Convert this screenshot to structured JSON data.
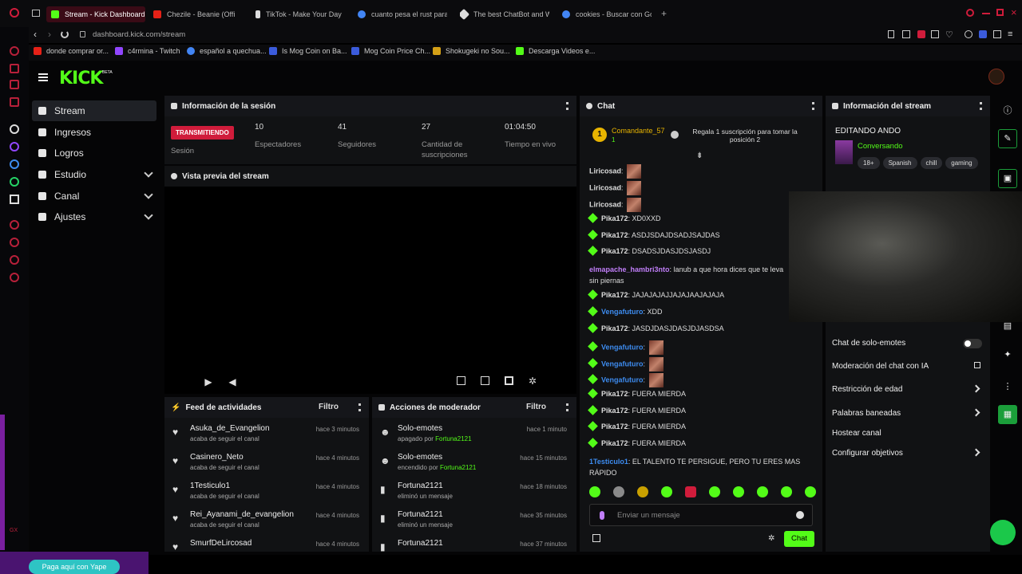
{
  "browser": {
    "tabs": [
      {
        "label": "Stream - Kick Dashboard",
        "color": "#53fc18",
        "active": true
      },
      {
        "label": "Chezile - Beanie (Offi",
        "color": "#e62117"
      },
      {
        "label": "TikTok - Make Your Day",
        "color": "#dddddd"
      },
      {
        "label": "cuanto pesa el rust para p",
        "color": "#4285f4"
      },
      {
        "label": "The best ChatBot and Wi",
        "color": "#dddddd"
      },
      {
        "label": "cookies - Buscar con Goo",
        "color": "#4285f4"
      }
    ],
    "url": "dashboard.kick.com/stream",
    "bookmarks": [
      {
        "label": "donde comprar or...",
        "color": "#e62117"
      },
      {
        "label": "c4rmina - Twitch",
        "color": "#9146ff"
      },
      {
        "label": "español a quechua...",
        "color": "#4285f4"
      },
      {
        "label": "Is Mog Coin on Ba...",
        "color": "#3b5bdb"
      },
      {
        "label": "Mog Coin Price Ch...",
        "color": "#3b5bdb"
      },
      {
        "label": "Shokugeki no Sou...",
        "color": "#d4a017"
      },
      {
        "label": "Descarga Videos e...",
        "color": "#53fc18"
      }
    ]
  },
  "app": {
    "logo": "KICK",
    "beta": "BETA",
    "accent": "#53fc18",
    "sidebar": [
      {
        "label": "Stream",
        "active": true
      },
      {
        "label": "Ingresos"
      },
      {
        "label": "Logros"
      },
      {
        "label": "Estudio",
        "expandable": true
      },
      {
        "label": "Canal",
        "expandable": true
      },
      {
        "label": "Ajustes",
        "expandable": true
      }
    ]
  },
  "session": {
    "title": "Información de la sesión",
    "badge": "TRANSMITIENDO",
    "badge_label": "Sesión",
    "stats": [
      {
        "value": "10",
        "label": "Espectadores"
      },
      {
        "value": "41",
        "label": "Seguidores"
      },
      {
        "value": "27",
        "label": "Cantidad de suscripciones"
      },
      {
        "value": "01:04:50",
        "label": "Tiempo en vivo"
      }
    ]
  },
  "preview": {
    "title": "Vista previa del stream"
  },
  "feed": {
    "title": "Feed de actividades",
    "filter": "Filtro",
    "rows": [
      {
        "name": "Asuka_de_Evangelion",
        "sub": "acaba de seguir el canal",
        "time": "hace 3 minutos"
      },
      {
        "name": "Casinero_Neto",
        "sub": "acaba de seguir el canal",
        "time": "hace 4 minutos"
      },
      {
        "name": "1Testiculo1",
        "sub": "acaba de seguir el canal",
        "time": "hace 4 minutos"
      },
      {
        "name": "Rei_Ayanami_de_evangelion",
        "sub": "acaba de seguir el canal",
        "time": "hace 4 minutos"
      },
      {
        "name": "SmurfDeLircosad",
        "sub": "",
        "time": "hace 4 minutos"
      }
    ]
  },
  "mod": {
    "title": "Acciones de moderador",
    "filter": "Filtro",
    "rows": [
      {
        "name": "Solo-emotes",
        "sub": "apagado por",
        "who": "Fortuna2121",
        "time": "hace 1 minuto"
      },
      {
        "name": "Solo-emotes",
        "sub": "encendido por",
        "who": "Fortuna2121",
        "time": "hace 15 minutos"
      },
      {
        "name": "Fortuna2121",
        "sub": "eliminó un mensaje",
        "who": "",
        "time": "hace 18 minutos"
      },
      {
        "name": "Fortuna2121",
        "sub": "eliminó un mensaje",
        "who": "",
        "time": "hace 35 minutos"
      },
      {
        "name": "Fortuna2121",
        "sub": "",
        "who": "",
        "time": "hace 37 minutos"
      }
    ]
  },
  "chat": {
    "title": "Chat",
    "pinned_user": "Comandante_57",
    "pinned_count": "1",
    "pinned_rank": "1",
    "gift_text": "Regala 1 suscripción para tomar la posición 2",
    "messages": [
      {
        "user": "Liricosad",
        "text": "",
        "emote": true,
        "color": "#dddddd",
        "gem": false
      },
      {
        "user": "Liricosad",
        "text": "",
        "emote": true,
        "color": "#dddddd",
        "gem": false
      },
      {
        "user": "Liricosad",
        "text": "",
        "emote": true,
        "color": "#dddddd",
        "gem": false
      },
      {
        "user": "Pika172",
        "text": "XD0XXD",
        "color": "#dddddd",
        "gem": true
      },
      {
        "user": "Pika172",
        "text": "ASDJSDAJDSADJSAJDAS",
        "color": "#dddddd",
        "gem": true
      },
      {
        "user": "Pika172",
        "text": "DSADSJDASJDSJASDJ",
        "color": "#dddddd",
        "gem": true
      },
      {
        "user": "elmapache_hambri3nto",
        "text": "lanub a que hora dices que te leva",
        "text2": "sin piernas",
        "color": "#c07ef8",
        "gem": false
      },
      {
        "user": "Pika172",
        "text": "JAJAJAJAJJAJAJAAJAJAJA",
        "color": "#dddddd",
        "gem": true
      },
      {
        "user": "Vengafuturo",
        "text": "XDD",
        "color": "#3d8cf0",
        "gem": true
      },
      {
        "user": "Pika172",
        "text": "JASDJDASJDASJDJASDSA",
        "color": "#dddddd",
        "gem": true
      },
      {
        "user": "Vengafuturo",
        "text": "",
        "emote": true,
        "color": "#3d8cf0",
        "gem": true
      },
      {
        "user": "Vengafuturo",
        "text": "",
        "emote": true,
        "color": "#3d8cf0",
        "gem": true
      },
      {
        "user": "Vengafuturo",
        "text": "",
        "emote": true,
        "color": "#3d8cf0",
        "gem": true
      },
      {
        "user": "Pika172",
        "text": "FUERA MIERDA",
        "color": "#dddddd",
        "gem": true
      },
      {
        "user": "Pika172",
        "text": "FUERA MIERDA",
        "color": "#dddddd",
        "gem": true
      },
      {
        "user": "Pika172",
        "text": "FUERA MIERDA",
        "color": "#dddddd",
        "gem": true
      },
      {
        "user": "Pika172",
        "text": "FUERA MIERDA",
        "color": "#dddddd",
        "gem": true
      },
      {
        "user": "1Testiculo1",
        "text": "EL TALENTO TE PERSIGUE, PERO TU ERES MAS",
        "text2": "RÁPIDO",
        "color": "#3d8cf0",
        "gem": false
      }
    ],
    "input_placeholder": "Enviar un mensaje",
    "send_label": "Chat"
  },
  "streaminfo": {
    "title": "Información del stream",
    "stream_title": "EDITANDO ANDO",
    "category": "Conversando",
    "tags": [
      "18+",
      "Spanish",
      "chill",
      "gaming"
    ],
    "settings": [
      {
        "label": "Chat de solo-emotes",
        "kind": "toggle"
      },
      {
        "label": "Moderación del chat con IA",
        "kind": "external"
      },
      {
        "label": "Restricción de edad",
        "kind": "arrow"
      },
      {
        "label": "Palabras baneadas",
        "kind": "arrow"
      },
      {
        "label": "Hostear canal",
        "kind": "none"
      },
      {
        "label": "Configurar objetivos",
        "kind": "arrow"
      }
    ]
  },
  "overlay": {
    "yape": "Paga aquí con Yape",
    "gx": "GX"
  }
}
